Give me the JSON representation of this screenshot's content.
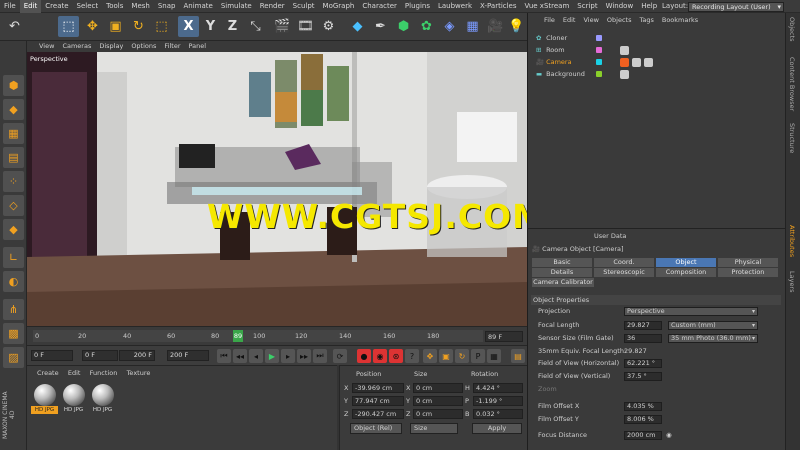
{
  "menubar": {
    "items": [
      "File",
      "Edit",
      "Create",
      "Select",
      "Tools",
      "Mesh",
      "Snap",
      "Animate",
      "Simulate",
      "Render",
      "Sculpt",
      "MoGraph",
      "Character",
      "Plugins",
      "Laubwerk",
      "X-Particles",
      "Vue xStream",
      "Script",
      "Window",
      "Help"
    ],
    "active_index": 1,
    "layout_label": "Layout:",
    "layout_value": "Recording Layout (User)"
  },
  "toolbar": {
    "icons": [
      "undo-icon",
      "live-selection-icon",
      "move-icon",
      "scale-icon",
      "rotate-icon",
      "recent-tool-icon",
      "x-axis-icon",
      "y-axis-icon",
      "z-axis-icon",
      "coordinate-system-icon",
      "render-view-icon",
      "render-pv-icon",
      "render-settings-icon",
      "cube-icon",
      "pen-spline-icon",
      "subdivision-icon",
      "cloner-icon",
      "deformer-icon",
      "floor-icon",
      "camera-icon",
      "light-icon"
    ],
    "axis_x": "X",
    "axis_y": "Y",
    "axis_z": "Z"
  },
  "viewport": {
    "menu": [
      "View",
      "Cameras",
      "Display",
      "Options",
      "Filter",
      "Panel"
    ],
    "label": "Perspective"
  },
  "watermark": "WWW.CGTSJ.COM",
  "timeline": {
    "ticks": [
      "0",
      "20",
      "40",
      "60",
      "80",
      "100",
      "120",
      "140",
      "160",
      "180"
    ],
    "current_frame": "89",
    "end_frame": "89 F"
  },
  "transport": {
    "start": "0 F",
    "min": "0 F",
    "max": "200 F",
    "end": "200 F"
  },
  "materials": {
    "menu": [
      "Create",
      "Edit",
      "Function",
      "Texture"
    ],
    "items": [
      {
        "label": "HD JPG",
        "selected": true
      },
      {
        "label": "HD JPG",
        "selected": false
      },
      {
        "label": "HD JPG",
        "selected": false
      }
    ],
    "brand_line1": "MAXON",
    "brand_line2": "CINEMA 4D"
  },
  "coordinates": {
    "headers": [
      "Position",
      "Size",
      "Rotation"
    ],
    "rows": [
      {
        "pos_axis": "X",
        "pos": "-39.969 cm",
        "size_axis": "X",
        "size": "0 cm",
        "rot_axis": "H",
        "rot": "4.424 °"
      },
      {
        "pos_axis": "Y",
        "pos": "77.947 cm",
        "size_axis": "Y",
        "size": "0 cm",
        "rot_axis": "P",
        "rot": "-1.199 °"
      },
      {
        "pos_axis": "Z",
        "pos": "-290.427 cm",
        "size_axis": "Z",
        "size": "0 cm",
        "rot_axis": "B",
        "rot": "0.032 °"
      }
    ],
    "mode": "Object (Rel)",
    "size_mode": "Size",
    "apply": "Apply"
  },
  "object_manager": {
    "menu": [
      "File",
      "Edit",
      "View",
      "Objects",
      "Tags",
      "Bookmarks"
    ],
    "objects": [
      {
        "name": "Cloner",
        "selected": false,
        "color": "#9a9aff"
      },
      {
        "name": "Room",
        "selected": false,
        "color": "#e56bd8"
      },
      {
        "name": "Camera",
        "selected": true,
        "color": "#1ad1e6"
      },
      {
        "name": "Background",
        "selected": false,
        "color": "#8ad02a"
      }
    ]
  },
  "attributes": {
    "header_label": "User Data",
    "title": "Camera Object [Camera]",
    "tabs": [
      "Basic",
      "Coord.",
      "Object",
      "Physical",
      "Details",
      "Stereoscopic",
      "Composition",
      "Protection",
      "Camera Calibrator"
    ],
    "active_tab": "Object",
    "section": "Object Properties",
    "props": [
      {
        "label": "Projection",
        "value": "Perspective"
      },
      {
        "label": "Focal Length",
        "value": "29.827",
        "extra": "Custom (mm)"
      },
      {
        "label": "Sensor Size (Film Gate)",
        "value": "36",
        "extra": "35 mm Photo (36.0 mm)"
      },
      {
        "label": "35mm Equiv. Focal Length:",
        "value": "29.827 mm"
      },
      {
        "label": "Field of View (Horizontal)",
        "value": "62.221 °"
      },
      {
        "label": "Field of View (Vertical)",
        "value": "37.5 °"
      },
      {
        "label": "Zoom",
        "value": ""
      },
      {
        "label": "Film Offset X",
        "value": "4.035 %"
      },
      {
        "label": "Film Offset Y",
        "value": "8.006 %"
      },
      {
        "label": "Focus Distance",
        "value": "2000 cm"
      }
    ]
  },
  "side_tabs": [
    "Objects",
    "Content Browser",
    "Structure",
    "Attributes",
    "Layers"
  ]
}
